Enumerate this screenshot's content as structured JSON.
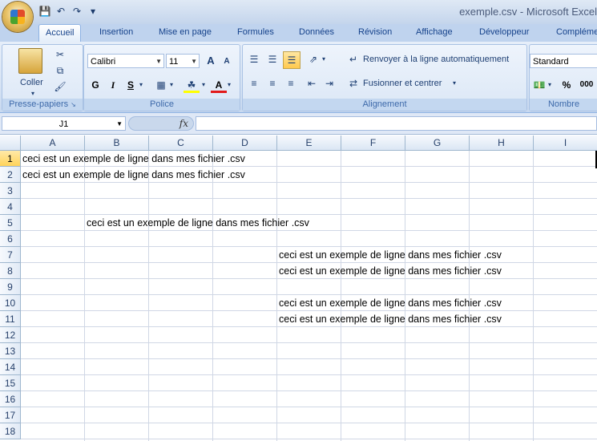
{
  "window": {
    "title": "exemple.csv - Microsoft Excel"
  },
  "quick_access": [
    "save-icon",
    "undo-icon",
    "redo-icon",
    "customize-qat-icon"
  ],
  "tabs": [
    "Accueil",
    "Insertion",
    "Mise en page",
    "Formules",
    "Données",
    "Révision",
    "Affichage",
    "Développeur",
    "Compléments"
  ],
  "active_tab": "Accueil",
  "ribbon": {
    "clipboard": {
      "paste_label": "Coller",
      "group_label": "Presse-papiers"
    },
    "font": {
      "name": "Calibri",
      "size": "11",
      "group_label": "Police",
      "bold": "G",
      "italic": "I",
      "underline": "S",
      "grow": "A",
      "shrink": "A",
      "color_a": "A"
    },
    "alignment": {
      "wrap_label": "Renvoyer à la ligne automatiquement",
      "merge_label": "Fusionner et centrer",
      "group_label": "Alignement"
    },
    "number": {
      "format": "Standard",
      "percent": "%",
      "thousands": "000",
      "group_label": "Nombre"
    }
  },
  "formula_bar": {
    "name_box": "J1",
    "fx": "fx",
    "formula": ""
  },
  "sheet": {
    "columns": [
      "A",
      "B",
      "C",
      "D",
      "E",
      "F",
      "G",
      "H",
      "I"
    ],
    "rows": [
      "1",
      "2",
      "3",
      "4",
      "5",
      "6",
      "7",
      "8",
      "9",
      "10",
      "11",
      "12",
      "13",
      "14",
      "15",
      "16",
      "17",
      "18"
    ],
    "cells": [
      {
        "ref": "A1",
        "text": "ceci est un exemple de ligne dans mes fichier .csv"
      },
      {
        "ref": "A2",
        "text": "ceci est un exemple de ligne dans mes fichier .csv"
      },
      {
        "ref": "B5",
        "text": "ceci est un exemple de ligne dans mes fichier .csv"
      },
      {
        "ref": "E7",
        "text": "ceci est un exemple de ligne dans mes fichier .csv"
      },
      {
        "ref": "E8",
        "text": "ceci est un exemple de ligne dans mes fichier .csv"
      },
      {
        "ref": "E10",
        "text": "ceci est un exemple de ligne dans mes fichier .csv"
      },
      {
        "ref": "E11",
        "text": "ceci est un exemple de ligne dans mes fichier .csv"
      }
    ],
    "selected_cell": "J1",
    "selected_row": "1"
  }
}
